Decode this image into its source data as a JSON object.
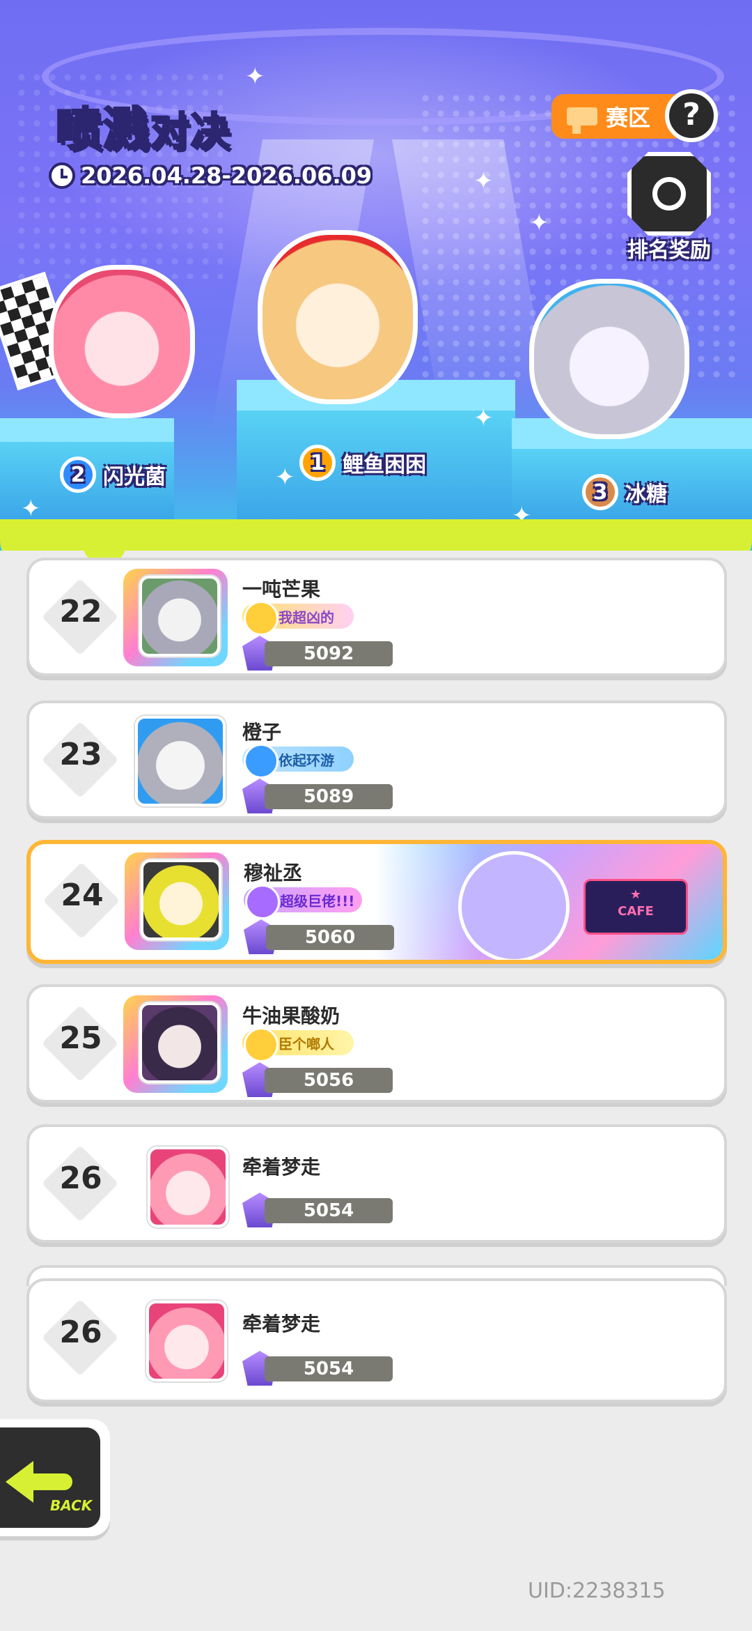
{
  "header": {
    "title_main": "喷溅",
    "title_suffix": "对决",
    "date_range": "2026.04.28-2026.06.09",
    "region_button": "赛区",
    "help_button": "?",
    "rank_reward_label": "排名奖励"
  },
  "podium": [
    {
      "rank": "2",
      "name": "闪光菌",
      "medal_color": "#2f8cff"
    },
    {
      "rank": "1",
      "name": "鲤鱼困困",
      "medal_color": "#ffa300"
    },
    {
      "rank": "3",
      "name": "冰糖",
      "medal_color": "#d98a4a"
    }
  ],
  "leaderboard": [
    {
      "rank": "22",
      "name": "一吨芒果",
      "tag": "我超凶的",
      "score": "5092",
      "tag_style": "yellow-pink"
    },
    {
      "rank": "23",
      "name": "橙子",
      "tag": "依起环游",
      "score": "5089",
      "tag_style": "blue"
    },
    {
      "rank": "24",
      "name": "穆祉丞",
      "tag": "超级巨佬!!!",
      "score": "5060",
      "tag_style": "purple",
      "highlighted": true
    },
    {
      "rank": "25",
      "name": "牛油果酸奶",
      "tag": "臣个啷人",
      "score": "5056",
      "tag_style": "yellow"
    },
    {
      "rank": "26",
      "name": "牵着梦走",
      "score": "5054"
    },
    {
      "rank": "26",
      "name": "牵着梦走",
      "score": "5054",
      "is_self": true
    }
  ],
  "footer": {
    "back_label": "BACK",
    "uid": "UID:2238315"
  },
  "colors": {
    "accent_yellow": "#ffe34a",
    "slime_green": "#d7f034",
    "highlight_border": "#ffb636",
    "region_orange": "#ff8c1a"
  }
}
